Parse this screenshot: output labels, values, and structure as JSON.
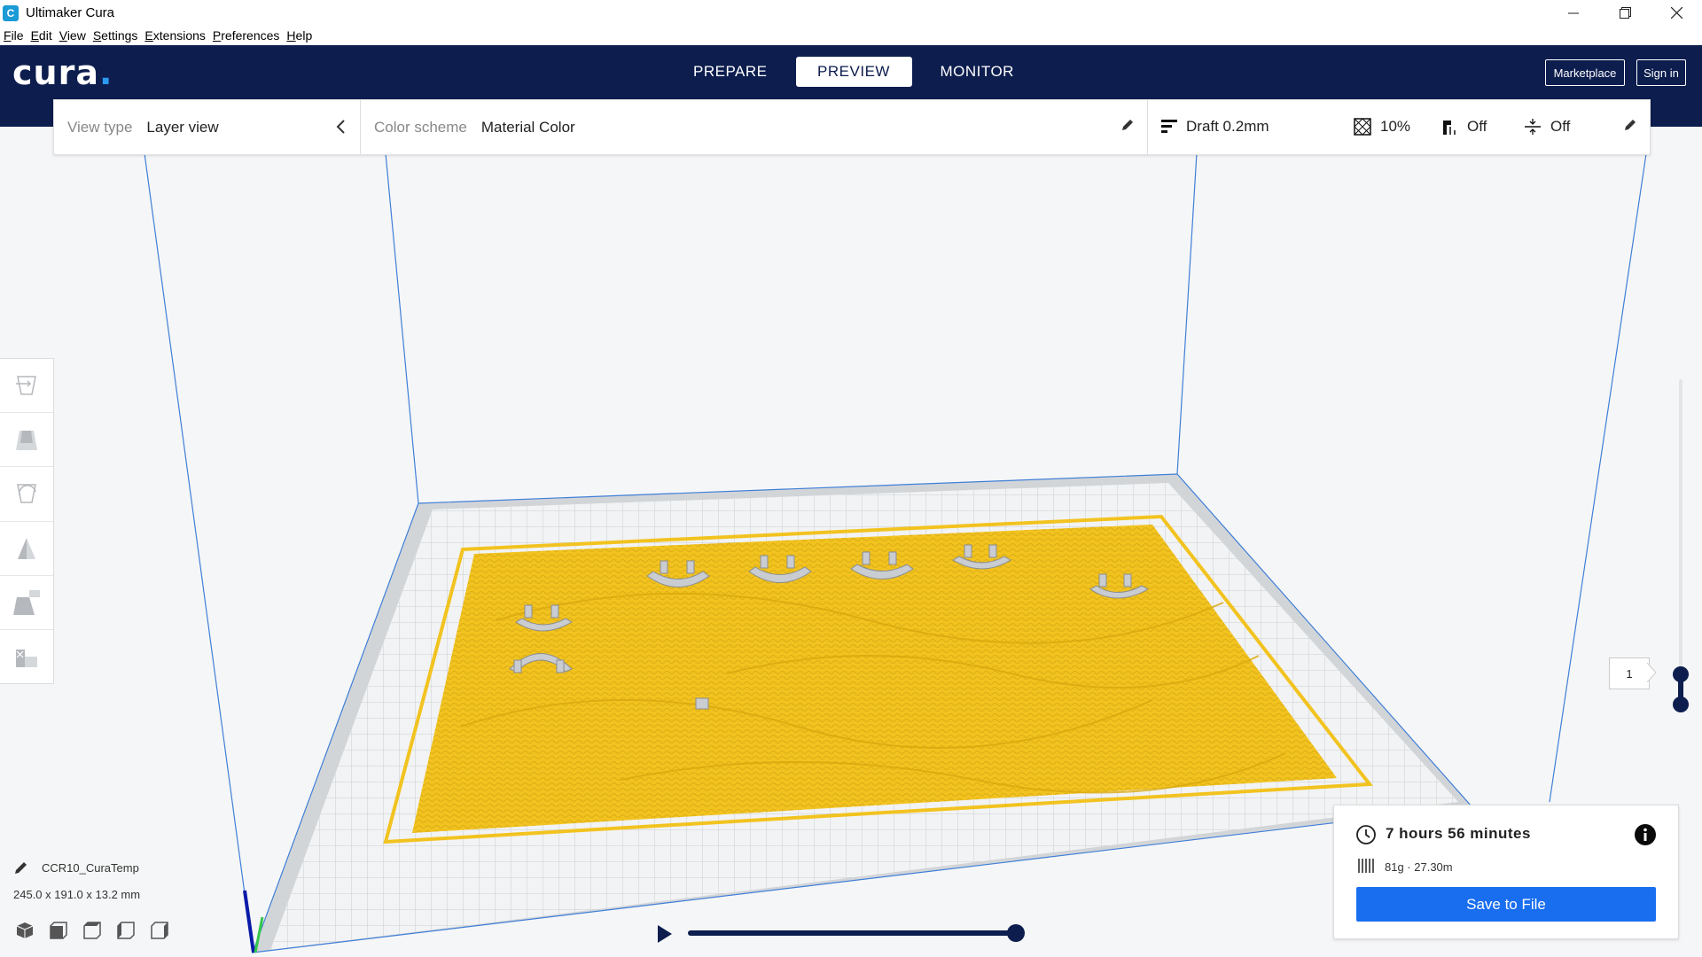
{
  "window": {
    "title": "Ultimaker Cura",
    "app_icon": "C"
  },
  "menu": [
    "File",
    "Edit",
    "View",
    "Settings",
    "Extensions",
    "Preferences",
    "Help"
  ],
  "header": {
    "logo": "cura",
    "stages": [
      "PREPARE",
      "PREVIEW",
      "MONITOR"
    ],
    "active_stage": "PREVIEW",
    "marketplace": "Marketplace",
    "signin": "Sign in",
    "bg_color": "#0c1d4e"
  },
  "toolbar": {
    "view_type_label": "View type",
    "view_type_value": "Layer view",
    "color_scheme_label": "Color scheme",
    "color_scheme_value": "Material Color",
    "profile": "Draft 0.2mm",
    "infill": "10%",
    "support": "Off",
    "adhesion": "Off"
  },
  "left_tools": [
    "move-icon",
    "scale-icon",
    "rotate-icon",
    "mirror-icon",
    "per-model-settings-icon",
    "support-blocker-icon"
  ],
  "machine": {
    "name": "CCR10_CuraTemp",
    "dimensions": "245.0 x 191.0 x 13.2 mm"
  },
  "layer": {
    "current": "1"
  },
  "print": {
    "time": "7 hours 56 minutes",
    "material": "81g · 27.30m",
    "save_label": "Save to File",
    "accent": "#196ef0"
  },
  "model_color": "#f2c31f"
}
